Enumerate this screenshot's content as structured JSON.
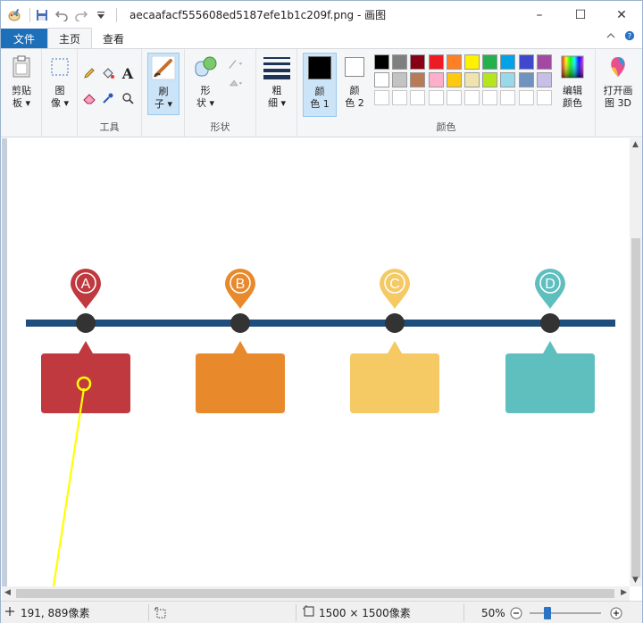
{
  "window": {
    "title": "aecaafacf555608ed5187efe1b1c209f.png - 画图",
    "controls": [
      "–",
      "☐",
      "✕"
    ]
  },
  "tabs": {
    "file": "文件",
    "home": "主页",
    "view": "查看"
  },
  "ribbon": {
    "clipboard": {
      "label_line1": "剪贴",
      "label_line2": "板 ▾"
    },
    "image": {
      "label_line1": "图",
      "label_line2": "像 ▾"
    },
    "tools": {
      "group_label": "工具",
      "text_glyph": "A"
    },
    "brush": {
      "label_line1": "刷",
      "label_line2": "子 ▾"
    },
    "shapes": {
      "label_line1": "形",
      "label_line2": "状 ▾",
      "group_label": "形状"
    },
    "size": {
      "label_line1": "粗",
      "label_line2": "细 ▾"
    },
    "color1": {
      "label_line1": "颜",
      "label_line2": "色 1"
    },
    "color2": {
      "label_line1": "颜",
      "label_line2": "色 2"
    },
    "colors_group_label": "颜色",
    "edit_colors": {
      "label_line1": "编辑",
      "label_line2": "颜色"
    },
    "paint3d": {
      "label_line1": "打开画",
      "label_line2": "图 3D"
    },
    "palette_row1": [
      "#000000",
      "#7f7f7f",
      "#880015",
      "#ed1c24",
      "#ff7f27",
      "#fff200",
      "#22b14c",
      "#00a2e8",
      "#3f48cc",
      "#a349a4"
    ],
    "palette_row2": [
      "#ffffff",
      "#c3c3c3",
      "#b97a57",
      "#ffaec9",
      "#ffc90e",
      "#efe4b0",
      "#b5e61d",
      "#99d9ea",
      "#7092be",
      "#c8bfe7"
    ],
    "palette_row3": [
      "#ffffff",
      "#ffffff",
      "#ffffff",
      "#ffffff",
      "#ffffff",
      "#ffffff",
      "#ffffff",
      "#ffffff",
      "#ffffff",
      "#ffffff"
    ]
  },
  "canvas_image": {
    "line_color": "#1e4e79",
    "dot_color": "#333333",
    "markers": [
      {
        "letter": "A",
        "color": "#c0393f"
      },
      {
        "letter": "B",
        "color": "#e8892b"
      },
      {
        "letter": "C",
        "color": "#f5c964"
      },
      {
        "letter": "D",
        "color": "#5fbfbf"
      }
    ],
    "annotation_color": "#ffff00"
  },
  "statusbar": {
    "cursor_pos": "191, 889像素",
    "image_size": "1500 × 1500像素",
    "zoom": "50%",
    "zoom_level": 0.5
  }
}
